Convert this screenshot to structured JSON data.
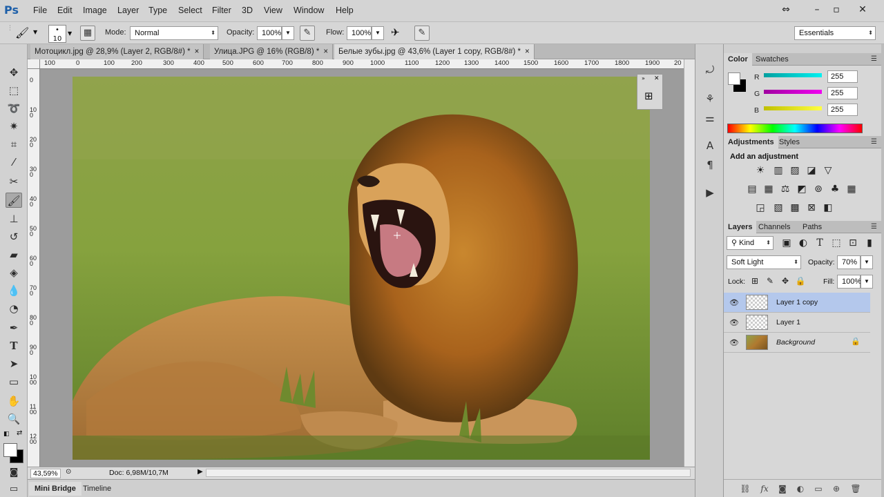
{
  "app": {
    "logo": "Ps"
  },
  "menu": [
    "File",
    "Edit",
    "Image",
    "Layer",
    "Type",
    "Select",
    "Filter",
    "3D",
    "View",
    "Window",
    "Help"
  ],
  "options": {
    "brush_size": "10",
    "mode_label": "Mode:",
    "mode_value": "Normal",
    "opacity_label": "Opacity:",
    "opacity_value": "100%",
    "flow_label": "Flow:",
    "flow_value": "100%",
    "workspace": "Essentials"
  },
  "tabs": [
    {
      "label": "Мотоцикл.jpg @ 28,9% (Layer 2, RGB/8#) *",
      "close": "×"
    },
    {
      "label": "Улица.JPG @ 16% (RGB/8) *",
      "close": "×"
    },
    {
      "label": "Белые зубы.jpg @ 43,6% (Layer 1 copy, RGB/8#) *",
      "close": "×"
    }
  ],
  "ruler_h": [
    "100",
    "0",
    "100",
    "200",
    "300",
    "400",
    "500",
    "600",
    "700",
    "800",
    "900",
    "1000",
    "1100",
    "1200",
    "1300",
    "1400",
    "1500",
    "1600",
    "1700",
    "1800",
    "1900",
    "20"
  ],
  "ruler_v": [
    "0",
    "100",
    "200",
    "300",
    "400",
    "500",
    "600",
    "700",
    "800",
    "900",
    "1000",
    "1100",
    "1200"
  ],
  "status": {
    "zoom": "43,59%",
    "doc": "Doc: 6,98M/10,7M"
  },
  "bottom_tabs": [
    "Mini Bridge",
    "Timeline"
  ],
  "color_panel": {
    "tabs": [
      "Color",
      "Swatches"
    ],
    "r_label": "R",
    "g_label": "G",
    "b_label": "B",
    "r": "255",
    "g": "255",
    "b": "255",
    "colors": {
      "r": "#00d8d8",
      "g": "#d000d0",
      "b": "#e0e000"
    }
  },
  "adjustments": {
    "tabs": [
      "Adjustments",
      "Styles"
    ],
    "heading": "Add an adjustment",
    "icons_row1": [
      "brightness-icon",
      "levels-icon",
      "curves-icon",
      "exposure-icon",
      "gradient-triangle-icon"
    ],
    "icons_row2": [
      "vibrance-icon",
      "hue-saturation-icon",
      "color-balance-icon",
      "black-white-icon",
      "photo-filter-icon",
      "channel-mixer-icon",
      "color-lookup-icon"
    ],
    "icons_row3": [
      "invert-icon",
      "posterize-icon",
      "threshold-icon",
      "selective-color-icon",
      "gradient-map-icon"
    ]
  },
  "layers_panel": {
    "tabs": [
      "Layers",
      "Channels",
      "Paths"
    ],
    "kind": "Kind",
    "blend_mode": "Soft Light",
    "opacity_label": "Opacity:",
    "opacity": "70%",
    "lock_label": "Lock:",
    "fill_label": "Fill:",
    "fill": "100%",
    "layers": [
      {
        "name": "Layer 1 copy",
        "selected": true
      },
      {
        "name": "Layer 1",
        "selected": false
      },
      {
        "name": "Background",
        "selected": false,
        "locked": true
      }
    ]
  }
}
